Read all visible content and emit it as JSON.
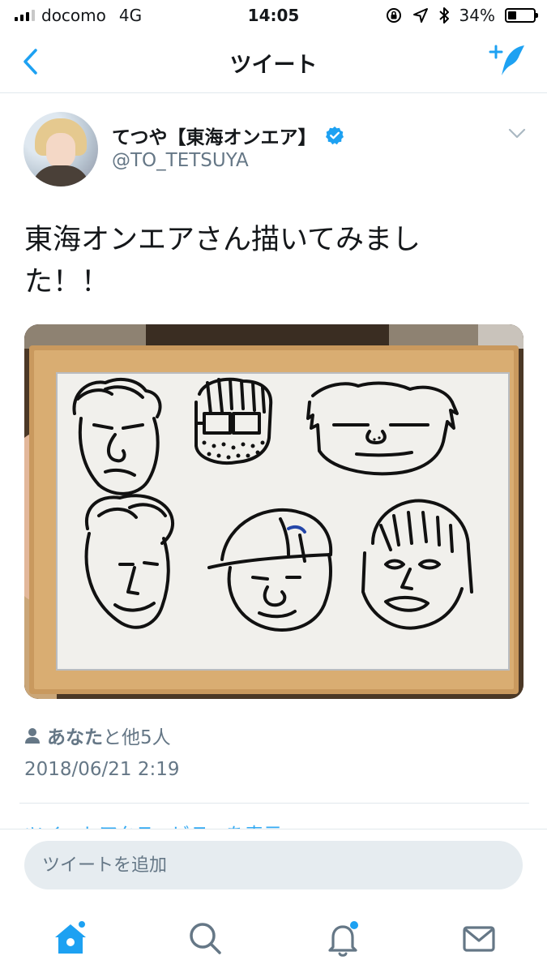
{
  "status_bar": {
    "carrier": "docomo",
    "network": "4G",
    "time": "14:05",
    "battery": "34%",
    "battery_level": 0.34
  },
  "nav": {
    "title": "ツイート",
    "icons": {
      "back": "chevron-left-icon",
      "compose": "compose-tweet-icon"
    }
  },
  "tweet": {
    "display_name": "てつや【東海オンエア】",
    "username": "@TO_TETSUYA",
    "verified": true,
    "text_line1": "東海オンエアさん描いてみまし",
    "text_line2": "た！！",
    "likes_name": "あなた",
    "likes_rest": "と他5人",
    "timestamp": "2018/06/21 2:19"
  },
  "activity_link": "ツイートアクティビティを表示",
  "reply": {
    "placeholder": "ツイートを追加"
  },
  "tab_bar": {
    "items": [
      "home-icon",
      "search-icon",
      "notifications-icon",
      "messages-icon"
    ]
  },
  "colors": {
    "accent": "#1da1f2",
    "secondary_text": "#657786",
    "divider": "#e1e8ed"
  }
}
